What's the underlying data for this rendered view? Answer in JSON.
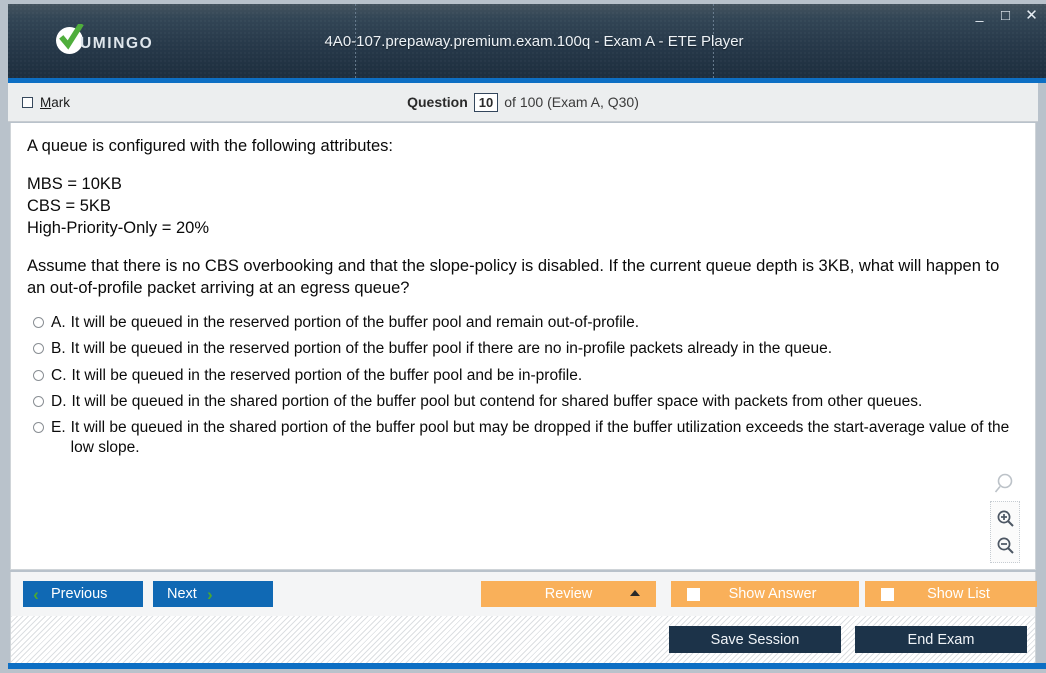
{
  "titlebar": {
    "brand_name": "UMINGO",
    "brand_icon": "check-circle-icon",
    "window_title": "4A0-107.prepaway.premium.exam.100q - Exam A - ETE Player",
    "minimize_glyph": "_",
    "maximize_glyph": "□",
    "close_glyph": "✕",
    "accent_color": "#0d6fc4"
  },
  "question_bar": {
    "mark_label_accel": "M",
    "mark_label_rest": "ark",
    "question_word": "Question",
    "question_number": "10",
    "rest": "of 100 (Exam A, Q30)"
  },
  "question": {
    "intro": "A queue is configured with the following attributes:",
    "attributes": [
      "MBS = 10KB",
      "CBS = 5KB",
      "High-Priority-Only = 20%"
    ],
    "prompt": "Assume that there is no CBS overbooking and that the slope-policy is disabled. If the current queue depth is 3KB, what will happen to an out-of-profile packet arriving at an egress queue?",
    "options": [
      {
        "letter": "A.",
        "text": "It will be queued in the reserved portion of the buffer pool and remain out-of-profile."
      },
      {
        "letter": "B.",
        "text": "It will be queued in the reserved portion of the buffer pool if there are no in-profile packets already in the queue."
      },
      {
        "letter": "C.",
        "text": "It will be queued in the reserved portion of the buffer pool and be in-profile."
      },
      {
        "letter": "D.",
        "text": "It will be queued in the shared portion of the buffer pool but contend for shared buffer space with packets from other queues."
      },
      {
        "letter": "E.",
        "text": "It will be queued in the shared portion of the buffer pool but may be dropped if the buffer utilization exceeds the start-average value of the low slope."
      }
    ]
  },
  "zoom_widget": {
    "glass_icon": "magnifier-icon",
    "zoom_in_icon": "zoom-in-icon",
    "zoom_out_icon": "zoom-out-icon"
  },
  "navbar": {
    "previous_label": "Previous",
    "next_label": "Next",
    "prev_chevron": "‹",
    "next_chevron": "›",
    "review_label": "Review",
    "show_answer_label": "Show Answer",
    "show_list_label": "Show List",
    "blue_color": "#1069b4",
    "orange_color": "#f9b05a",
    "chevron_color": "#4aa832"
  },
  "footer": {
    "save_session_label": "Save Session",
    "end_exam_label": "End Exam",
    "navy_color": "#1c3349"
  }
}
